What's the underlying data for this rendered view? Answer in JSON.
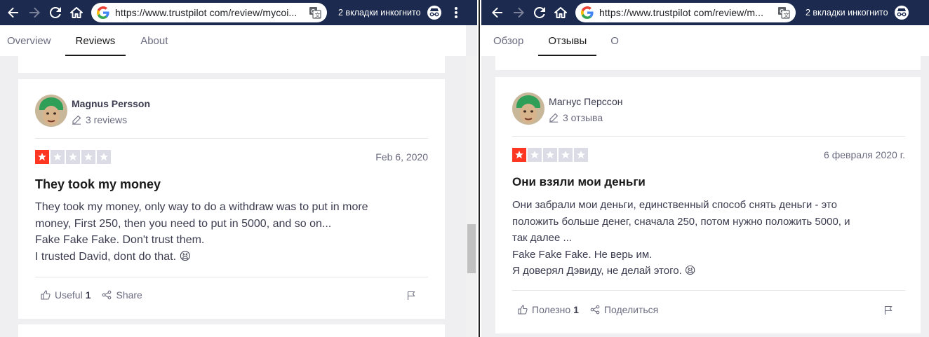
{
  "left": {
    "url": "https://www.trustpilot com/review/mycoi...",
    "incognito": "2 вкладки инкогнито",
    "tabs": [
      "Overview",
      "Reviews",
      "About"
    ],
    "review": {
      "name": "Magnus Persson",
      "count": "3 reviews",
      "date": "Feb 6, 2020",
      "rating": 1,
      "title": "They took my money",
      "body": [
        "They took my money, only way to do a withdraw was to put in more",
        "money, First 250, then you need to put in 5000, and so on...",
        "Fake Fake Fake. Don't trust them.",
        "I trusted David, dont do that. 😫"
      ],
      "useful_label": "Useful",
      "useful_count": "1",
      "share_label": "Share"
    }
  },
  "right": {
    "url": "https://www.trustpilot com/review/m...",
    "incognito": "2 вкладки инкогнито",
    "tabs": [
      "Обзор",
      "Отзывы",
      "О"
    ],
    "review": {
      "name": "Магнус Перссон",
      "count": "3 отзыва",
      "date": "6 февраля 2020 г.",
      "rating": 1,
      "title": "Они взяли мои деньги",
      "body": [
        "Они забрали мои деньги, единственный способ снять деньги - это",
        "положить больше денег, сначала 250, потом нужно положить 5000, и",
        "так далее ...",
        "Fake Fake Fake. Не верь им.",
        "Я доверял Дэвиду, не делай этого. 😫"
      ],
      "useful_label": "Полезно",
      "useful_count": "1",
      "share_label": "Поделиться"
    }
  },
  "colors": {
    "toolbar": "#1b2a4e",
    "star_on": "#ff3722",
    "star_off": "#dcdce6",
    "page_bg": "#efeff1"
  }
}
